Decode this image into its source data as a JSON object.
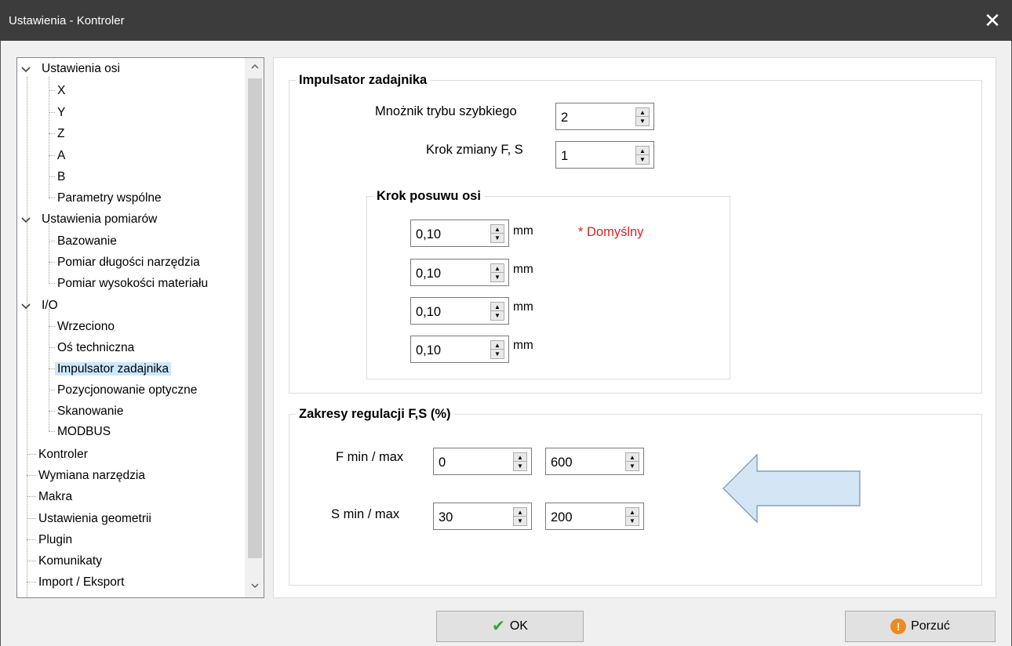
{
  "window": {
    "title": "Ustawienia - Kontroler"
  },
  "tree": {
    "items": [
      {
        "label": "Ustawienia osi"
      },
      {
        "label": "X"
      },
      {
        "label": "Y"
      },
      {
        "label": "Z"
      },
      {
        "label": "A"
      },
      {
        "label": "B"
      },
      {
        "label": "Parametry wspólne"
      },
      {
        "label": "Ustawienia pomiarów"
      },
      {
        "label": "Bazowanie"
      },
      {
        "label": "Pomiar długości narzędzia"
      },
      {
        "label": "Pomiar wysokości materiału"
      },
      {
        "label": "I/O"
      },
      {
        "label": "Wrzeciono"
      },
      {
        "label": "Oś techniczna"
      },
      {
        "label": "Impulsator zadajnika"
      },
      {
        "label": "Pozycjonowanie optyczne"
      },
      {
        "label": "Skanowanie"
      },
      {
        "label": "MODBUS"
      },
      {
        "label": "Kontroler"
      },
      {
        "label": "Wymiana narzędzia"
      },
      {
        "label": "Makra"
      },
      {
        "label": "Ustawienia geometrii"
      },
      {
        "label": "Plugin"
      },
      {
        "label": "Komunikaty"
      },
      {
        "label": "Import / Eksport"
      }
    ],
    "selected": "Impulsator zadajnika"
  },
  "impulsator": {
    "legend": "Impulsator zadajnika",
    "fast_mode_label": "Mnożnik trybu szybkiego",
    "fast_mode_value": "2",
    "fs_step_label": "Krok zmiany F, S",
    "fs_step_value": "1",
    "axis_step": {
      "legend": "Krok posuwu osi",
      "rows": [
        {
          "value": "0,10",
          "unit": "mm"
        },
        {
          "value": "0,10",
          "unit": "mm"
        },
        {
          "value": "0,10",
          "unit": "mm"
        },
        {
          "value": "0,10",
          "unit": "mm"
        }
      ],
      "default_note": "* Domyślny"
    }
  },
  "ranges": {
    "legend": "Zakresy regulacji F,S (%)",
    "f_label": "F min / max",
    "f_min": "0",
    "f_max": "600",
    "s_label": "S min / max",
    "s_min": "30",
    "s_max": "200"
  },
  "buttons": {
    "ok": "OK",
    "cancel": "Porzuć"
  },
  "colors": {
    "arrow_fill": "#d4e6f5",
    "arrow_stroke": "#6f8fb0",
    "note": "#e02020",
    "selection": "#cce8ff"
  }
}
